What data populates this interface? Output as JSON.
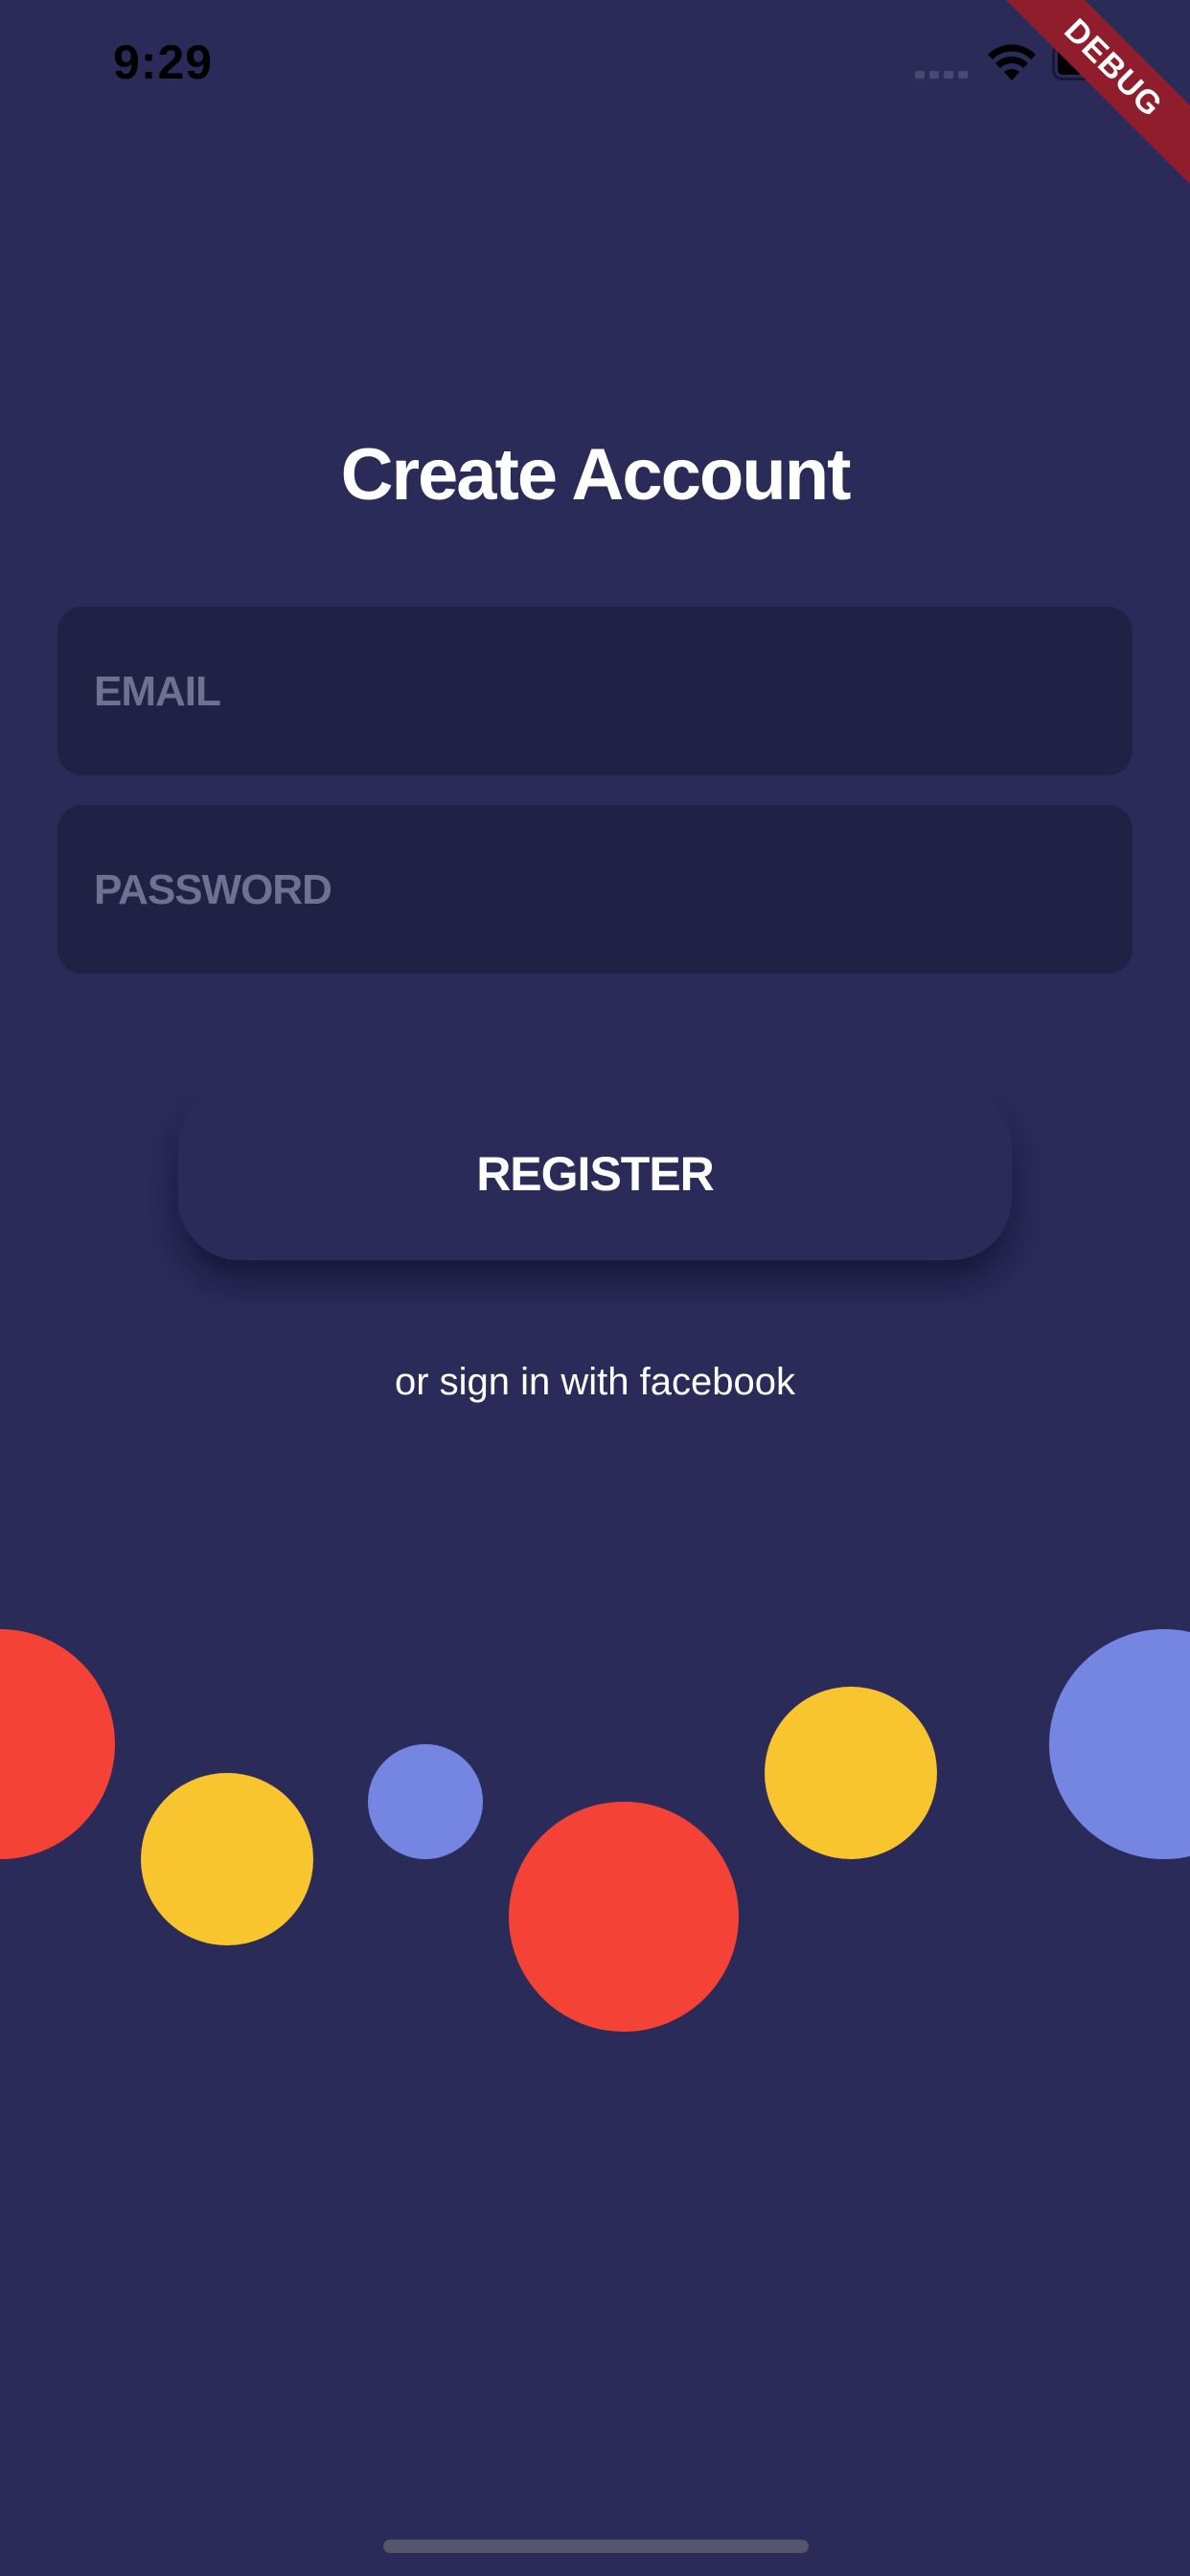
{
  "status_bar": {
    "time": "9:29",
    "icons": [
      "signal-icon",
      "wifi-icon",
      "battery-icon"
    ]
  },
  "debug_banner": {
    "label": "DEBUG"
  },
  "page": {
    "title": "Create Account"
  },
  "form": {
    "email": {
      "placeholder": "EMAIL",
      "value": ""
    },
    "password": {
      "placeholder": "PASSWORD",
      "value": ""
    },
    "register_label": "REGISTER",
    "facebook_link": "or sign in with facebook"
  },
  "colors": {
    "background": "#2b2b5a",
    "input_background": "#1f2145",
    "placeholder": "#6f7190",
    "red": "#f44336",
    "yellow": "#f8c52f",
    "blue": "#7585e2",
    "debug_ribbon": "#8f1d2c"
  }
}
